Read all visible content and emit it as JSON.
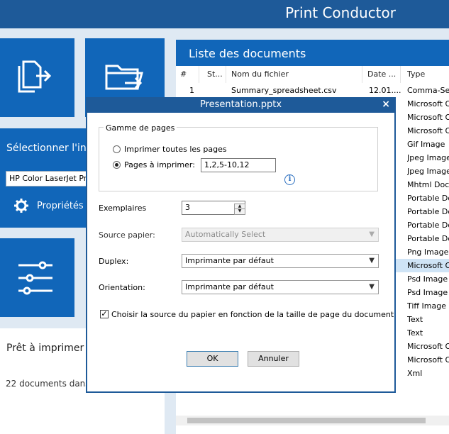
{
  "app": {
    "title": "Print Conductor"
  },
  "left": {
    "select_printer_label": "Sélectionner l'in",
    "printer_value": "HP Color LaserJet Pr",
    "properties_label": "Propriétés d",
    "status": "Prêt à imprimer",
    "documents_count": "22 documents dans"
  },
  "list": {
    "title": "Liste des documents",
    "columns": [
      "#",
      "St...",
      "Nom du fichier",
      "Date ...",
      "Type"
    ],
    "first_row": {
      "num": "1",
      "name": "Summary_spreadsheet.csv",
      "date": "12.01....",
      "type": "Comma-Se"
    },
    "types": [
      "Microsoft O",
      "Microsoft O",
      "Microsoft O",
      "Gif Image",
      "Jpeg Image",
      "Jpeg Image",
      "Mhtml Doc",
      "Portable Do",
      "Portable Do",
      "Portable Do",
      "Portable Do",
      "Png Image",
      "Microsoft O",
      "Psd Image",
      "Psd Image",
      "Tiff Image",
      "Text",
      "Text",
      "Microsoft O",
      "Microsoft O",
      "Xml"
    ],
    "highlighted_type_index": 12
  },
  "dialog": {
    "title": "Presentation.pptx",
    "page_range_group": "Gamme de pages",
    "print_all_label": "Imprimer toutes les pages",
    "pages_to_print_label": "Pages à imprimer:",
    "pages_value": "1,2,5-10,12",
    "copies_label": "Exemplaires",
    "copies_value": "3",
    "paper_source_label": "Source papier:",
    "paper_source_value": "Automatically Select",
    "duplex_label": "Duplex:",
    "duplex_value": "Imprimante par défaut",
    "orientation_label": "Orientation:",
    "orientation_value": "Imprimante par défaut",
    "auto_source_label": "Choisir la source du papier en fonction de la taille de page du document",
    "ok_label": "OK",
    "cancel_label": "Annuler",
    "info_glyph": "i",
    "close_glyph": "×",
    "check_glyph": "✓"
  },
  "colors": {
    "titlebar": "#1e5a99",
    "tile": "#1166b9",
    "background": "#dfe9f3",
    "highlight": "#cfe4f6"
  }
}
